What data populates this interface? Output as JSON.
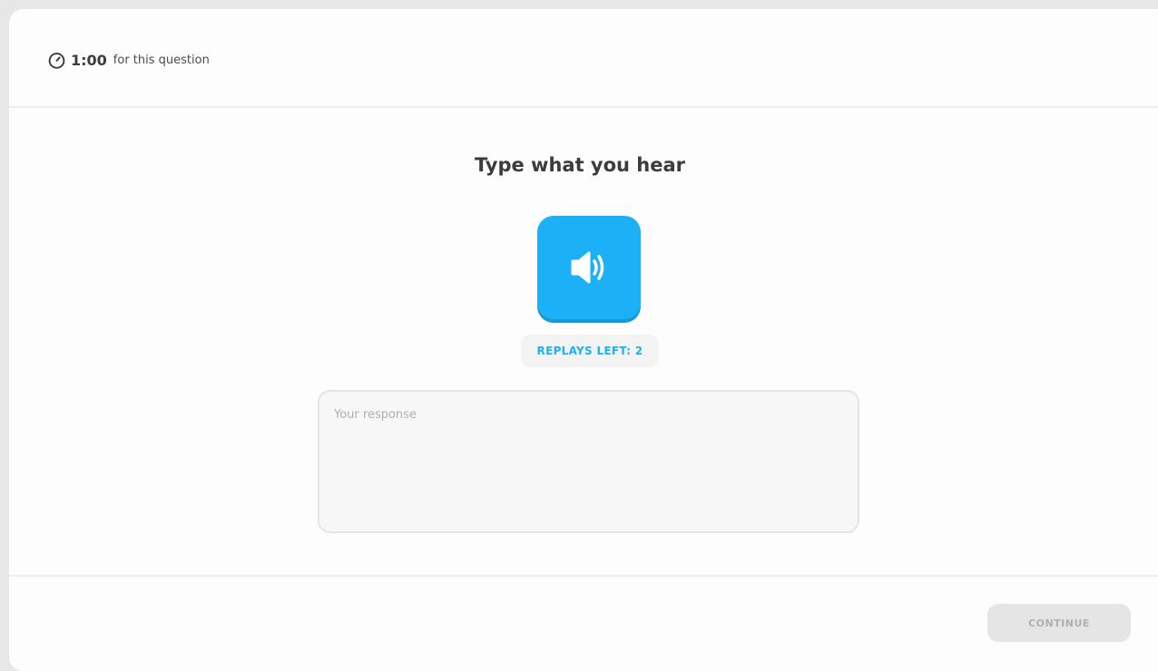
{
  "header": {
    "timer_value": "1:00",
    "timer_suffix": "for this question",
    "timer_icon": "stopwatch-icon"
  },
  "challenge": {
    "title": "Type what you hear",
    "audio_icon": "speaker-icon",
    "replays_label": "REPLAYS LEFT: 2"
  },
  "response": {
    "value": "",
    "placeholder": "Your response"
  },
  "footer": {
    "continue_label": "CONTINUE"
  },
  "colors": {
    "accent": "#1cb0f6",
    "accent_shadow": "#1899d6",
    "disabled_bg": "#e5e5e5",
    "disabled_text": "#afafaf",
    "text": "#3c3c3c"
  }
}
